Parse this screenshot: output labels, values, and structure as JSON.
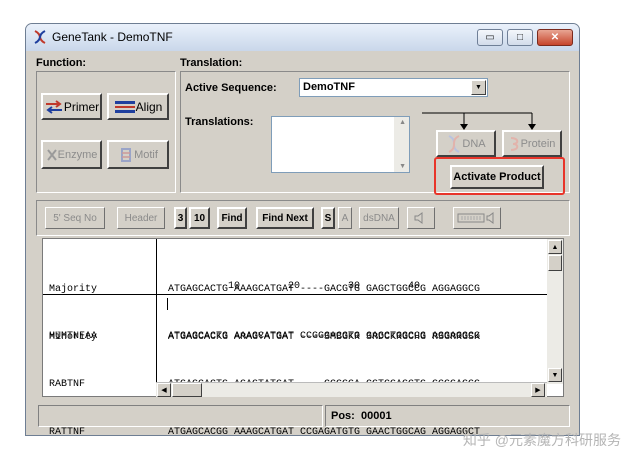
{
  "window": {
    "title": "GeneTank - DemoTNF",
    "min_glyph": "▭",
    "max_glyph": "□",
    "close_glyph": "✕"
  },
  "function_panel": {
    "label": "Function:",
    "primer_label": "Primer",
    "align_label": "Align",
    "enzyme_label": "Enzyme",
    "motif_label": "Motif"
  },
  "translation_panel": {
    "label": "Translation:",
    "active_sequence_label": "Active Sequence:",
    "active_sequence_value": "DemoTNF",
    "translations_label": "Translations:",
    "dna_label": "DNA",
    "protein_label": "Protein",
    "activate_label": "Activate Product"
  },
  "toolbar": {
    "seqno": "5' Seq No",
    "header": "Header",
    "three": "3",
    "ten": "10",
    "find": "Find",
    "find_next": "Find Next",
    "s": "S",
    "a": "A",
    "dsdna": "dsDNA"
  },
  "alignment": {
    "names_top": [
      "Majority",
      "Minority"
    ],
    "seq_top": [
      "ATGAGCACTG AAAGCATGAT ----GACGTG GAGCTGGCCG AGGAGGCG",
      "ATGAGCACKG ARAGYATGAT ----SMBGKR SRDCKRGCHG RSGRRGSK"
    ],
    "ruler": "          10        20        30        40",
    "names_bottom": [
      "HUMTNFAA",
      "RABTNF",
      "RATTNF"
    ],
    "seq_bottom": [
      "ATGAGCACTG AAAGCATGAT CCGGGACGTG GAGCTGGCCG AGGAGGCG",
      "ATGAGCACTG AGAGTATGAT ----CCGGGA CGTCGAGCTG GCGGAGGG",
      "ATGAGCACGG AAAGCATGAT CCGAGATGTG GAACTGGCAG AGGAGGCT"
    ]
  },
  "status": {
    "pos_label": "Pos:",
    "pos_value": "00001"
  },
  "watermark": "知乎 @元素魔方科研服务",
  "colors": {
    "highlight": "#e8352a",
    "accent": "#1a3d9e"
  }
}
